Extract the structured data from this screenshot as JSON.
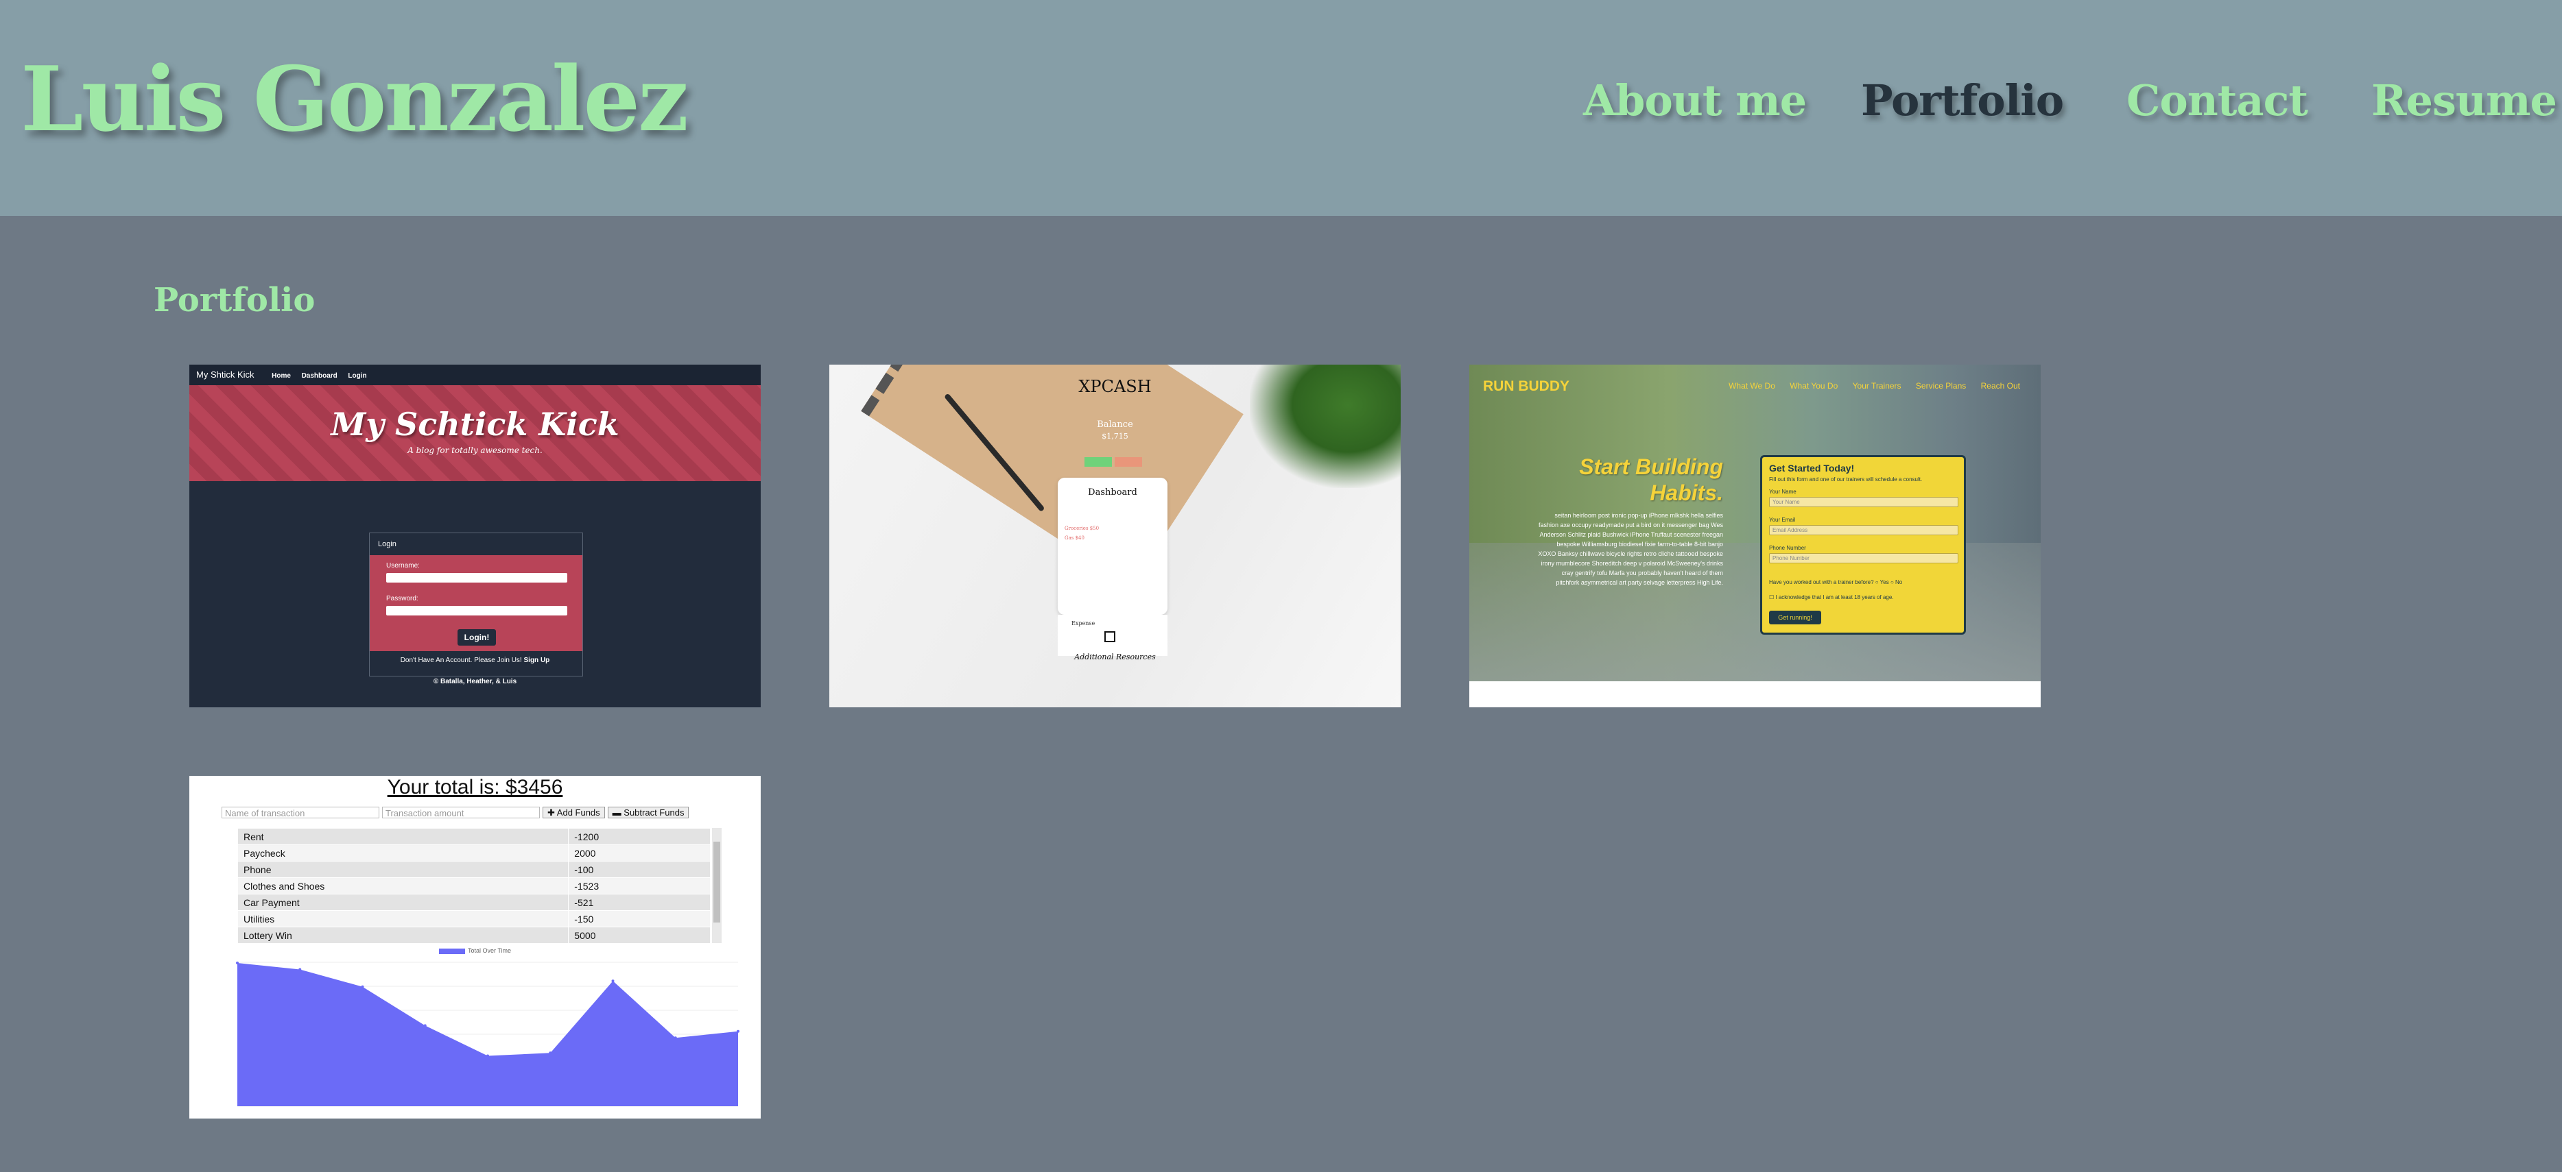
{
  "header": {
    "brand": "Luis Gonzalez",
    "nav": [
      {
        "label": "About me"
      },
      {
        "label": "Portfolio"
      },
      {
        "label": "Contact"
      },
      {
        "label": "Resume"
      }
    ]
  },
  "main": {
    "section_title": "Portfolio"
  },
  "project1": {
    "app": "My Shtick Kick",
    "nav": [
      "Home",
      "Dashboard",
      "Login"
    ],
    "hero_title": "My Schtick Kick",
    "hero_sub": "A blog for totally awesome tech.",
    "login_header": "Login",
    "username_label": "Username:",
    "password_label": "Password:",
    "login_button": "Login!",
    "signup_prompt": "Don't Have An Account. Please Join Us!",
    "signup_link": "Sign Up",
    "footer": "© Batalla, Heather, & Luis"
  },
  "project2": {
    "logo": "XPCASH",
    "balance_label": "Balance",
    "balance_value": "$1,715",
    "dashboard": "Dashboard",
    "row1": "Groceries $50",
    "row2": "Gas $40",
    "expense": "Expense",
    "additional": "Additional Resources"
  },
  "project3": {
    "brand": "RUN BUDDY",
    "links": [
      "What We Do",
      "What You Do",
      "Your Trainers",
      "Service Plans",
      "Reach Out"
    ],
    "headline1": "Start Building",
    "headline2": "Habits.",
    "paragraph": "seitan heirloom post ironic pop-up iPhone mlkshk hella selfies fashion axe occupy readymade put a bird on it messenger bag Wes Anderson Schlitz plaid Bushwick iPhone Truffaut scenester freegan bespoke Williamsburg biodiesel fixie farm-to-table 8-bit banjo XOXO Banksy chillwave bicycle rights retro cliche tattooed bespoke irony mumblecore Shoreditch deep v polaroid McSweeney's drinks cray gentrify tofu Marfa you probably haven't heard of them pitchfork asymmetrical art party selvage letterpress High Life.",
    "form_title": "Get Started Today!",
    "form_sub": "Fill out this form and one of our trainers will schedule a consult.",
    "name_label": "Your Name",
    "name_ph": "Your Name",
    "email_label": "Your Email",
    "email_ph": "Email Address",
    "phone_label": "Phone Number",
    "phone_ph": "Phone Number",
    "question": "Have you worked out with a trainer before?",
    "yes": "Yes",
    "no": "No",
    "ack": "I acknowledge that I am at least 18 years of age.",
    "button": "Get running!"
  },
  "project4": {
    "total": "Your total is: $3456",
    "name_ph": "Name of transaction",
    "amount_ph": "Transaction amount",
    "add": "✚ Add Funds",
    "subtract": "▬ Subtract Funds",
    "transactions": [
      [
        "Rent",
        "-1200"
      ],
      [
        "Paycheck",
        "2000"
      ],
      [
        "Phone",
        "-100"
      ],
      [
        "Clothes and Shoes",
        "-1523"
      ],
      [
        "Car Payment",
        "-521"
      ],
      [
        "Utilities",
        "-150"
      ],
      [
        "Lottery Win",
        "5000"
      ]
    ],
    "legend": "Total Over Time",
    "chart_data": {
      "type": "area",
      "series": [
        {
          "name": "Total Over Time",
          "values": [
            14950,
            14500,
            13300,
            10600,
            8500,
            8700,
            13700,
            9750,
            10200
          ]
        }
      ],
      "ylim": [
        5000,
        15000
      ],
      "color": "#6b6bf7"
    }
  }
}
